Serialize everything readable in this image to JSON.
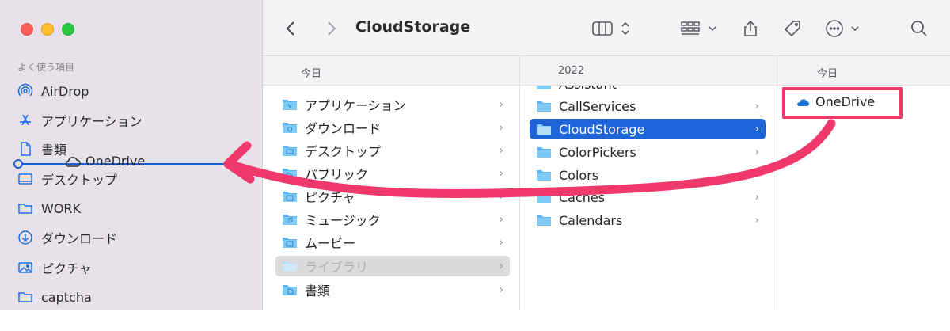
{
  "window": {
    "title": "CloudStorage"
  },
  "sidebar": {
    "heading": "よく使う項目",
    "items": [
      {
        "label": "AirDrop",
        "icon": "airdrop-icon"
      },
      {
        "label": "アプリケーション",
        "icon": "applications-icon"
      },
      {
        "label": "書類",
        "icon": "document-icon"
      },
      {
        "label": "デスクトップ",
        "icon": "desktop-icon"
      },
      {
        "label": "WORK",
        "icon": "folder-icon"
      },
      {
        "label": "ダウンロード",
        "icon": "download-icon"
      },
      {
        "label": "ピクチャ",
        "icon": "pictures-icon"
      },
      {
        "label": "captcha",
        "icon": "folder-icon"
      }
    ],
    "drag_ghost_label": "OneDrive"
  },
  "toolbar": {
    "back_icon": "chevron-left-icon",
    "forward_icon": "chevron-right-icon",
    "view_icon": "column-view-icon",
    "group_icon": "grid-group-icon",
    "share_icon": "share-icon",
    "tag_icon": "tag-icon",
    "more_icon": "ellipsis-circle-icon",
    "search_icon": "search-icon"
  },
  "columns": [
    {
      "header": "今日",
      "items": [
        {
          "label": "アプリケーション",
          "state": "normal"
        },
        {
          "label": "ダウンロード",
          "state": "normal"
        },
        {
          "label": "デスクトップ",
          "state": "normal"
        },
        {
          "label": "パブリック",
          "state": "normal"
        },
        {
          "label": "ピクチャ",
          "state": "normal"
        },
        {
          "label": "ミュージック",
          "state": "normal"
        },
        {
          "label": "ムービー",
          "state": "normal"
        },
        {
          "label": "ライブラリ",
          "state": "dim"
        },
        {
          "label": "書類",
          "state": "normal"
        }
      ]
    },
    {
      "header": "2022",
      "items": [
        {
          "label": "Assistant",
          "state": "partial"
        },
        {
          "label": "CallServices",
          "state": "normal"
        },
        {
          "label": "CloudStorage",
          "state": "selected"
        },
        {
          "label": "ColorPickers",
          "state": "normal"
        },
        {
          "label": "Colors",
          "state": "normal"
        },
        {
          "label": "Caches",
          "state": "normal"
        },
        {
          "label": "Calendars",
          "state": "normal"
        }
      ]
    },
    {
      "header": "今日",
      "items": [
        {
          "label": "OneDrive",
          "state": "highlighted"
        }
      ]
    }
  ],
  "colors": {
    "accent": "#1e63d8",
    "annotation": "#f1386b",
    "folder": "#5bb4f0"
  }
}
